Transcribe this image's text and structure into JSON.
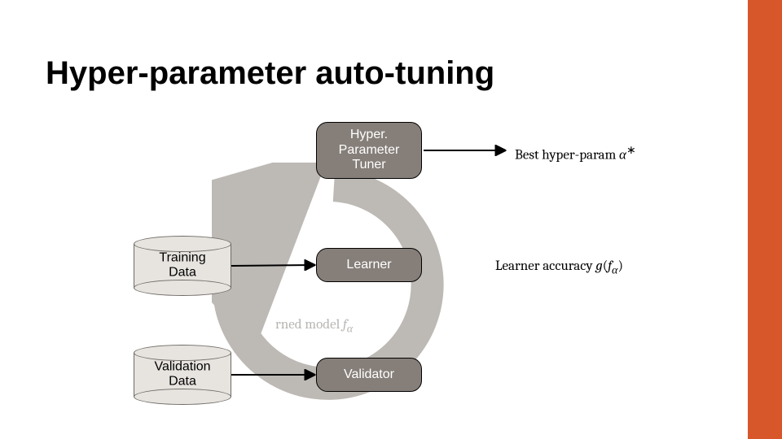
{
  "accent_color": "#d7572b",
  "title": "Hyper-parameter auto-tuning",
  "nodes": {
    "tuner_l1": "Hyper.",
    "tuner_l2": "Parameter",
    "tuner_l3": "Tuner",
    "learner": "Learner",
    "validator": "Validator"
  },
  "cylinders": {
    "train_l1": "Training",
    "train_l2": "Data",
    "valid_l1": "Validation",
    "valid_l2": "Data"
  },
  "labels": {
    "best_prefix": "Best hyper-param ",
    "best_sym": "α",
    "best_sup": "∗",
    "accuracy_prefix": "Learner accuracy ",
    "accuracy_g": "g",
    "accuracy_f": "f",
    "accuracy_alpha": "α",
    "learned_prefix": "rned model ",
    "learned_f": "f",
    "learned_alpha": "α"
  }
}
